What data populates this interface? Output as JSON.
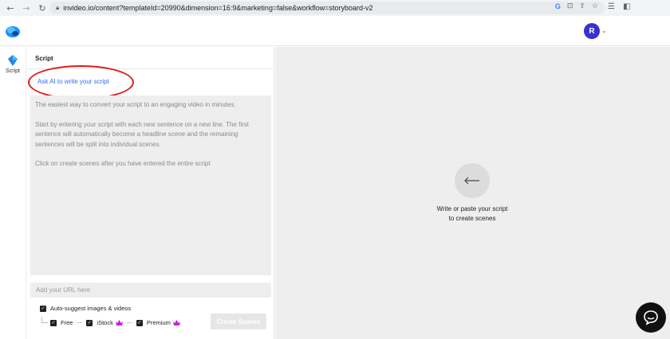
{
  "browser": {
    "url": "invideo.io/content?templateId=20990&dimension=16:9&marketing=false&workflow=storyboard-v2",
    "back_icon": "←",
    "forward_icon": "→",
    "reload_icon": "↻"
  },
  "header": {
    "avatar_initial": "R"
  },
  "rail": {
    "items": [
      {
        "label": "Script",
        "icon": "script-icon"
      }
    ]
  },
  "panel": {
    "title": "Script",
    "ask_ai_label": "Ask AI to write your script",
    "placeholder_lines": [
      "The easiest way to convert your script to an engaging video in minutes.",
      "Start by entering your script with each new sentence on a new line. The first sentence will automatically become a headline scene and the remaining sentences will be split into individual scenes.",
      "Click on create scenes after you have entered the entire script"
    ],
    "url_placeholder": "Add your URL here",
    "auto_suggest_label": "Auto-suggest images & videos",
    "sources": [
      {
        "label": "Free",
        "checked": true,
        "premium": false
      },
      {
        "label": "iStock",
        "checked": true,
        "premium": true
      },
      {
        "label": "Premium",
        "checked": true,
        "premium": true
      }
    ],
    "create_button": "Create Scenes"
  },
  "preview": {
    "hint_line1": "Write or paste your script",
    "hint_line2": "to create scenes"
  },
  "colors": {
    "accent_link": "#2d6df6",
    "avatar": "#3b2fd1",
    "crown": "#c026d3",
    "annotation_red": "#e01b1b"
  }
}
